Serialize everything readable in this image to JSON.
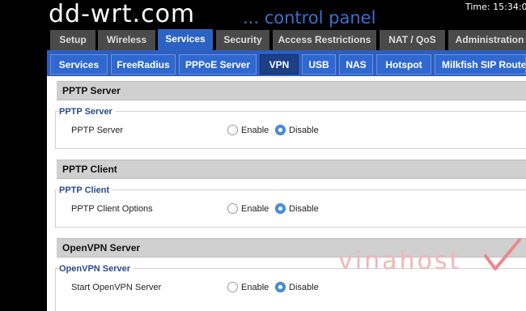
{
  "header": {
    "logo": "dd-wrt.com",
    "tagline": "... control panel",
    "time": "Time: 15:34:04"
  },
  "main_tabs": [
    {
      "label": "Setup",
      "active": false
    },
    {
      "label": "Wireless",
      "active": false
    },
    {
      "label": "Services",
      "active": true
    },
    {
      "label": "Security",
      "active": false
    },
    {
      "label": "Access Restrictions",
      "active": false
    },
    {
      "label": "NAT / QoS",
      "active": false
    },
    {
      "label": "Administration",
      "active": false
    }
  ],
  "sub_tabs": [
    {
      "label": "Services",
      "active": false
    },
    {
      "label": "FreeRadius",
      "active": false
    },
    {
      "label": "PPPoE Server",
      "active": false
    },
    {
      "label": "VPN",
      "active": true
    },
    {
      "label": "USB",
      "active": false
    },
    {
      "label": "NAS",
      "active": false
    },
    {
      "label": "Hotspot",
      "active": false
    },
    {
      "label": "Milkfish SIP Router",
      "active": false
    }
  ],
  "sections": [
    {
      "title": "PPTP Server",
      "legend": "PPTP Server",
      "row_label": "PPTP Server",
      "options": [
        "Enable",
        "Disable"
      ],
      "selected": "Disable"
    },
    {
      "title": "PPTP Client",
      "legend": "PPTP Client",
      "row_label": "PPTP Client Options",
      "options": [
        "Enable",
        "Disable"
      ],
      "selected": "Disable"
    },
    {
      "title": "OpenVPN Server",
      "legend": "OpenVPN Server",
      "row_label": "Start OpenVPN Server",
      "options": [
        "Enable",
        "Disable"
      ],
      "selected": "Disable"
    }
  ],
  "watermark": "vinahost",
  "colors": {
    "tab_active": "#2b62c4",
    "tab_inactive": "#4a4a4a",
    "legend_text": "#2a4a90",
    "radio_checked": "#4a90e2"
  }
}
